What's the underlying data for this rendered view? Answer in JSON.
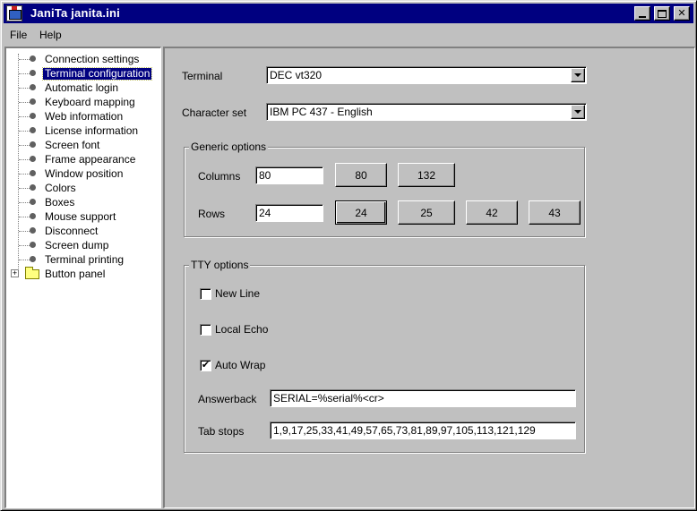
{
  "window": {
    "title": "JaniTa  janita.ini"
  },
  "menu": {
    "items": [
      "File",
      "Help"
    ]
  },
  "tree": {
    "items": [
      {
        "label": "Connection settings"
      },
      {
        "label": "Terminal configuration",
        "selected": true
      },
      {
        "label": "Automatic login"
      },
      {
        "label": "Keyboard mapping"
      },
      {
        "label": "Web information"
      },
      {
        "label": "License information"
      },
      {
        "label": "Screen font"
      },
      {
        "label": "Frame appearance"
      },
      {
        "label": "Window position"
      },
      {
        "label": "Colors"
      },
      {
        "label": "Boxes"
      },
      {
        "label": "Mouse support"
      },
      {
        "label": "Disconnect"
      },
      {
        "label": "Screen dump"
      },
      {
        "label": "Terminal printing"
      }
    ],
    "folder": {
      "label": "Button panel",
      "expander": "+"
    }
  },
  "terminal": {
    "label": "Terminal",
    "value": "DEC vt320"
  },
  "charset": {
    "label": "Character set",
    "value": "IBM PC 437 - English"
  },
  "generic": {
    "title": "Generic options",
    "columns": {
      "label": "Columns",
      "value": "80",
      "presets": [
        "80",
        "132"
      ]
    },
    "rows": {
      "label": "Rows",
      "value": "24",
      "presets": [
        "24",
        "25",
        "42",
        "43"
      ],
      "default_preset": "24"
    }
  },
  "tty": {
    "title": "TTY options",
    "new_line": {
      "label": "New Line",
      "checked": false
    },
    "local_echo": {
      "label": "Local Echo",
      "checked": false
    },
    "auto_wrap": {
      "label": "Auto Wrap",
      "checked": true,
      "mark": "✔"
    },
    "answerback": {
      "label": "Answerback",
      "value": "SERIAL=%serial%<cr>"
    },
    "tab_stops": {
      "label": "Tab stops",
      "value": "1,9,17,25,33,41,49,57,65,73,81,89,97,105,113,121,129"
    }
  }
}
